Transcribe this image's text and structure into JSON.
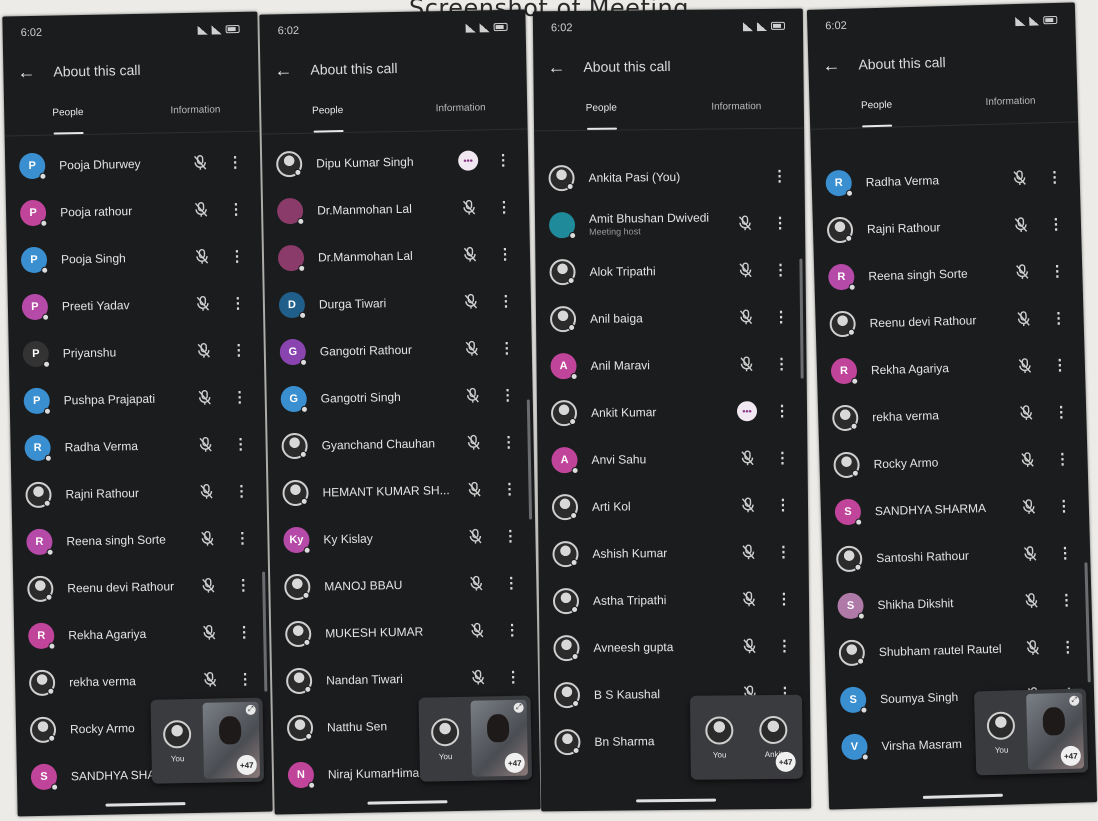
{
  "heading": "Screenshot of Meeting",
  "colors": {
    "phone_bg": "#1b1c1e",
    "avatar_blue": "#3a8fd1",
    "avatar_pink": "#c0449a",
    "avatar_purple": "#8a44b0",
    "avatar_teal": "#1f8a9a",
    "avatar_dark": "#333333",
    "talk_badge": "#f1e8f1"
  },
  "screens": [
    {
      "status": {
        "time": "6:02"
      },
      "header": {
        "title": "About this call"
      },
      "tabs": [
        {
          "label": "People",
          "active": true
        },
        {
          "label": "Information",
          "active": false
        }
      ],
      "people": [
        {
          "name": "Pooja Dhurwey",
          "initial": "P",
          "avatar_color": "#3a8fd1",
          "status": "muted"
        },
        {
          "name": "Pooja rathour",
          "initial": "P",
          "avatar_color": "#c0449a",
          "status": "muted"
        },
        {
          "name": "Pooja Singh",
          "initial": "P",
          "avatar_color": "#3a8fd1",
          "status": "muted"
        },
        {
          "name": "Preeti Yadav",
          "initial": "P",
          "avatar_color": "#b64aa8",
          "status": "muted"
        },
        {
          "name": "Priyanshu",
          "initial": "P",
          "avatar_color": "#333333",
          "status": "muted"
        },
        {
          "name": "Pushpa Prajapati",
          "initial": "P",
          "avatar_color": "#3a8fd1",
          "status": "muted"
        },
        {
          "name": "Radha Verma",
          "initial": "R",
          "avatar_color": "#3a8fd1",
          "status": "muted"
        },
        {
          "name": "Rajni Rathour",
          "initial": "",
          "avatar_color": "photo",
          "status": "muted"
        },
        {
          "name": "Reena singh Sorte",
          "initial": "R",
          "avatar_color": "#b64aa8",
          "status": "muted"
        },
        {
          "name": "Reenu devi Rathour",
          "initial": "",
          "avatar_color": "photo",
          "status": "muted"
        },
        {
          "name": "Rekha Agariya",
          "initial": "R",
          "avatar_color": "#c0449a",
          "status": "muted"
        },
        {
          "name": "rekha verma",
          "initial": "",
          "avatar_color": "photo",
          "status": "muted"
        },
        {
          "name": "Rocky Armo",
          "initial": "",
          "avatar_color": "photo",
          "status": "muted"
        },
        {
          "name": "SANDHYA SHARMA",
          "initial": "S",
          "avatar_color": "#c0449a",
          "status": "muted"
        }
      ],
      "pip": {
        "you_label": "You",
        "count": "+47"
      }
    },
    {
      "status": {
        "time": "6:02"
      },
      "header": {
        "title": "About this call"
      },
      "tabs": [
        {
          "label": "People",
          "active": true
        },
        {
          "label": "Information",
          "active": false
        }
      ],
      "people": [
        {
          "name": "Dipu Kumar Singh",
          "initial": "",
          "avatar_color": "photo",
          "status": "talking"
        },
        {
          "name": "Dr.Manmohan Lal",
          "initial": "",
          "avatar_color": "#8a3b6a",
          "status": "muted"
        },
        {
          "name": "Dr.Manmohan Lal",
          "initial": "",
          "avatar_color": "#8a3b6a",
          "status": "muted"
        },
        {
          "name": "Durga Tiwari",
          "initial": "D",
          "avatar_color": "#1f5f8a",
          "status": "muted"
        },
        {
          "name": "Gangotri Rathour",
          "initial": "G",
          "avatar_color": "#8a44b0",
          "status": "muted"
        },
        {
          "name": "Gangotri Singh",
          "initial": "G",
          "avatar_color": "#3a8fd1",
          "status": "muted"
        },
        {
          "name": "Gyanchand Chauhan",
          "initial": "",
          "avatar_color": "photo",
          "status": "muted"
        },
        {
          "name": "HEMANT KUMAR SH...",
          "initial": "",
          "avatar_color": "photo",
          "status": "muted"
        },
        {
          "name": "Ky Kislay",
          "initial": "Ky",
          "avatar_color": "#b64aa8",
          "status": "muted"
        },
        {
          "name": "MANOJ BBAU",
          "initial": "",
          "avatar_color": "photo",
          "status": "muted"
        },
        {
          "name": "MUKESH KUMAR",
          "initial": "",
          "avatar_color": "photo",
          "status": "muted"
        },
        {
          "name": "Nandan Tiwari",
          "initial": "",
          "avatar_color": "photo",
          "status": "muted"
        },
        {
          "name": "Natthu Sen",
          "initial": "",
          "avatar_color": "photo",
          "status": "muted"
        },
        {
          "name": "Niraj KumarHimanshu",
          "initial": "N",
          "avatar_color": "#c0449a",
          "status": "muted"
        }
      ],
      "pip": {
        "you_label": "You",
        "count": "+47"
      }
    },
    {
      "status": {
        "time": "6:02"
      },
      "header": {
        "title": "About this call"
      },
      "tabs": [
        {
          "label": "People",
          "active": true
        },
        {
          "label": "Information",
          "active": false
        }
      ],
      "people": [
        {
          "name": "Ankita Pasi (You)",
          "initial": "",
          "avatar_color": "photo",
          "status": "none"
        },
        {
          "name": "Amit Bhushan Dwivedi",
          "subtitle": "Meeting host",
          "initial": "",
          "avatar_color": "#1f8a9a",
          "status": "muted"
        },
        {
          "name": "Alok Tripathi",
          "initial": "",
          "avatar_color": "photo",
          "status": "muted"
        },
        {
          "name": "Anil baiga",
          "initial": "",
          "avatar_color": "photo",
          "status": "muted"
        },
        {
          "name": "Anil Maravi",
          "initial": "A",
          "avatar_color": "#c0449a",
          "status": "muted"
        },
        {
          "name": "Ankit Kumar",
          "initial": "",
          "avatar_color": "photo",
          "status": "talking"
        },
        {
          "name": "Anvi Sahu",
          "initial": "A",
          "avatar_color": "#c0449a",
          "status": "muted"
        },
        {
          "name": "Arti Kol",
          "initial": "",
          "avatar_color": "photo",
          "status": "muted"
        },
        {
          "name": "Ashish Kumar",
          "initial": "",
          "avatar_color": "photo",
          "status": "muted"
        },
        {
          "name": "Astha Tripathi",
          "initial": "",
          "avatar_color": "photo",
          "status": "muted"
        },
        {
          "name": "Avneesh gupta",
          "initial": "",
          "avatar_color": "photo",
          "status": "muted"
        },
        {
          "name": "B S Kaushal",
          "initial": "",
          "avatar_color": "photo",
          "status": "muted"
        },
        {
          "name": "Bn Sharma",
          "initial": "",
          "avatar_color": "photo",
          "status": "muted"
        }
      ],
      "pip": {
        "you_label": "You",
        "other_label": "Ankit",
        "count": "+47"
      }
    },
    {
      "status": {
        "time": "6:02"
      },
      "header": {
        "title": "About this call"
      },
      "tabs": [
        {
          "label": "People",
          "active": true
        },
        {
          "label": "Information",
          "active": false
        }
      ],
      "people": [
        {
          "name": "Radha Verma",
          "initial": "R",
          "avatar_color": "#3a8fd1",
          "status": "muted"
        },
        {
          "name": "Rajni Rathour",
          "initial": "",
          "avatar_color": "photo",
          "status": "muted"
        },
        {
          "name": "Reena singh Sorte",
          "initial": "R",
          "avatar_color": "#b64aa8",
          "status": "muted"
        },
        {
          "name": "Reenu devi Rathour",
          "initial": "",
          "avatar_color": "photo",
          "status": "muted"
        },
        {
          "name": "Rekha Agariya",
          "initial": "R",
          "avatar_color": "#c0449a",
          "status": "muted"
        },
        {
          "name": "rekha verma",
          "initial": "",
          "avatar_color": "photo",
          "status": "muted"
        },
        {
          "name": "Rocky Armo",
          "initial": "",
          "avatar_color": "photo",
          "status": "muted"
        },
        {
          "name": "SANDHYA SHARMA",
          "initial": "S",
          "avatar_color": "#c0449a",
          "status": "muted"
        },
        {
          "name": "Santoshi Rathour",
          "initial": "",
          "avatar_color": "photo",
          "status": "muted"
        },
        {
          "name": "Shikha Dikshit",
          "initial": "S",
          "avatar_color": "#b07aa8",
          "status": "muted"
        },
        {
          "name": "Shubham rautel Rautel",
          "initial": "",
          "avatar_color": "photo",
          "status": "muted"
        },
        {
          "name": "Soumya Singh",
          "initial": "S",
          "avatar_color": "#3a8fd1",
          "status": "muted"
        },
        {
          "name": "Virsha Masram",
          "initial": "V",
          "avatar_color": "#3a8fd1",
          "status": "muted"
        }
      ],
      "pip": {
        "you_label": "You",
        "count": "+47"
      }
    }
  ]
}
